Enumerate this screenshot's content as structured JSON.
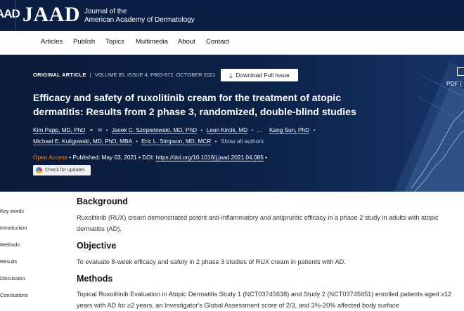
{
  "brand": {
    "prev_fragment": "AAD",
    "logo": "JAAD",
    "subtitle_line1": "Journal of the",
    "subtitle_line2": "American Academy of Dermatology"
  },
  "nav": {
    "items": [
      "Articles",
      "Publish",
      "Topics",
      "Multimedia",
      "About",
      "Contact"
    ]
  },
  "article": {
    "type": "ORIGINAL ARTICLE",
    "separator": "|",
    "volume": "VOLUME 85, ISSUE 4, P863-872, OCTOBER 2021",
    "download_label": "Download Full Issue",
    "pdf_label": "PDF [",
    "title": "Efficacy and safety of ruxolitinib cream for the treatment of atopic dermatitis: Results from 2 phase 3, randomized, double-blind studies",
    "authors_row1": [
      "Kim Papp, MD, PhD",
      "Jacek C. Szepietowski, MD, PhD",
      "Leon Kircik, MD",
      "...",
      "Kang Sun, PhD"
    ],
    "authors_row2": [
      "Michael E. Kuligowski, MD, PhD, MBA",
      "Eric L. Simpson, MD, MCR"
    ],
    "show_all": "Show all authors",
    "open_access": "Open Access",
    "published": "Published: May 03, 2021",
    "doi_prefix": "DOI:",
    "doi": "https://doi.org/10.1016/j.jaad.2021.04.085",
    "check_updates": "Check for updates"
  },
  "side_nav": {
    "items": [
      "Key words",
      "Introduction",
      "Methods",
      "Results",
      "Discussion",
      "Conclusions"
    ]
  },
  "sections": [
    {
      "heading": "Background",
      "text": "Ruxolitinib (RUX) cream demonstrated potent anti-inflammatory and antipruritic efficacy in a phase 2 study in adults with atopic dermatitis (AD)."
    },
    {
      "heading": "Objective",
      "text": "To evaluate 8-week efficacy and safety in 2 phase 3 studies of RUX cream in patients with AD."
    },
    {
      "heading": "Methods",
      "text": "Topical Ruxolitinib Evaluation in Atopic Dermatitis Study 1 (NCT03745638) and Study 2 (NCT03745651) enrolled patients aged ≥12 years with AD for ≥2 years, an Investigator's Global Assessment score of 2/3, and 3%-20% affected body surface"
    }
  ]
}
